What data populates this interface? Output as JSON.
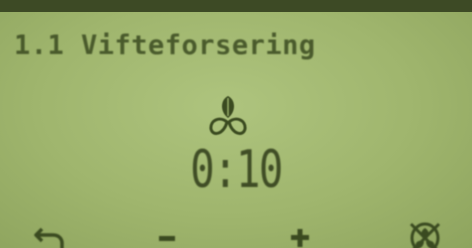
{
  "title": "1.1 Vifteforsering",
  "timer": "0:10",
  "icons": {
    "fan": "fan-icon",
    "back": "back-arrow-icon",
    "minus": "minus-icon",
    "plus": "plus-icon",
    "cancel": "crossed-fan-icon"
  },
  "colors": {
    "lcd_background": "#a5ba73",
    "lcd_text": "#34431c"
  }
}
